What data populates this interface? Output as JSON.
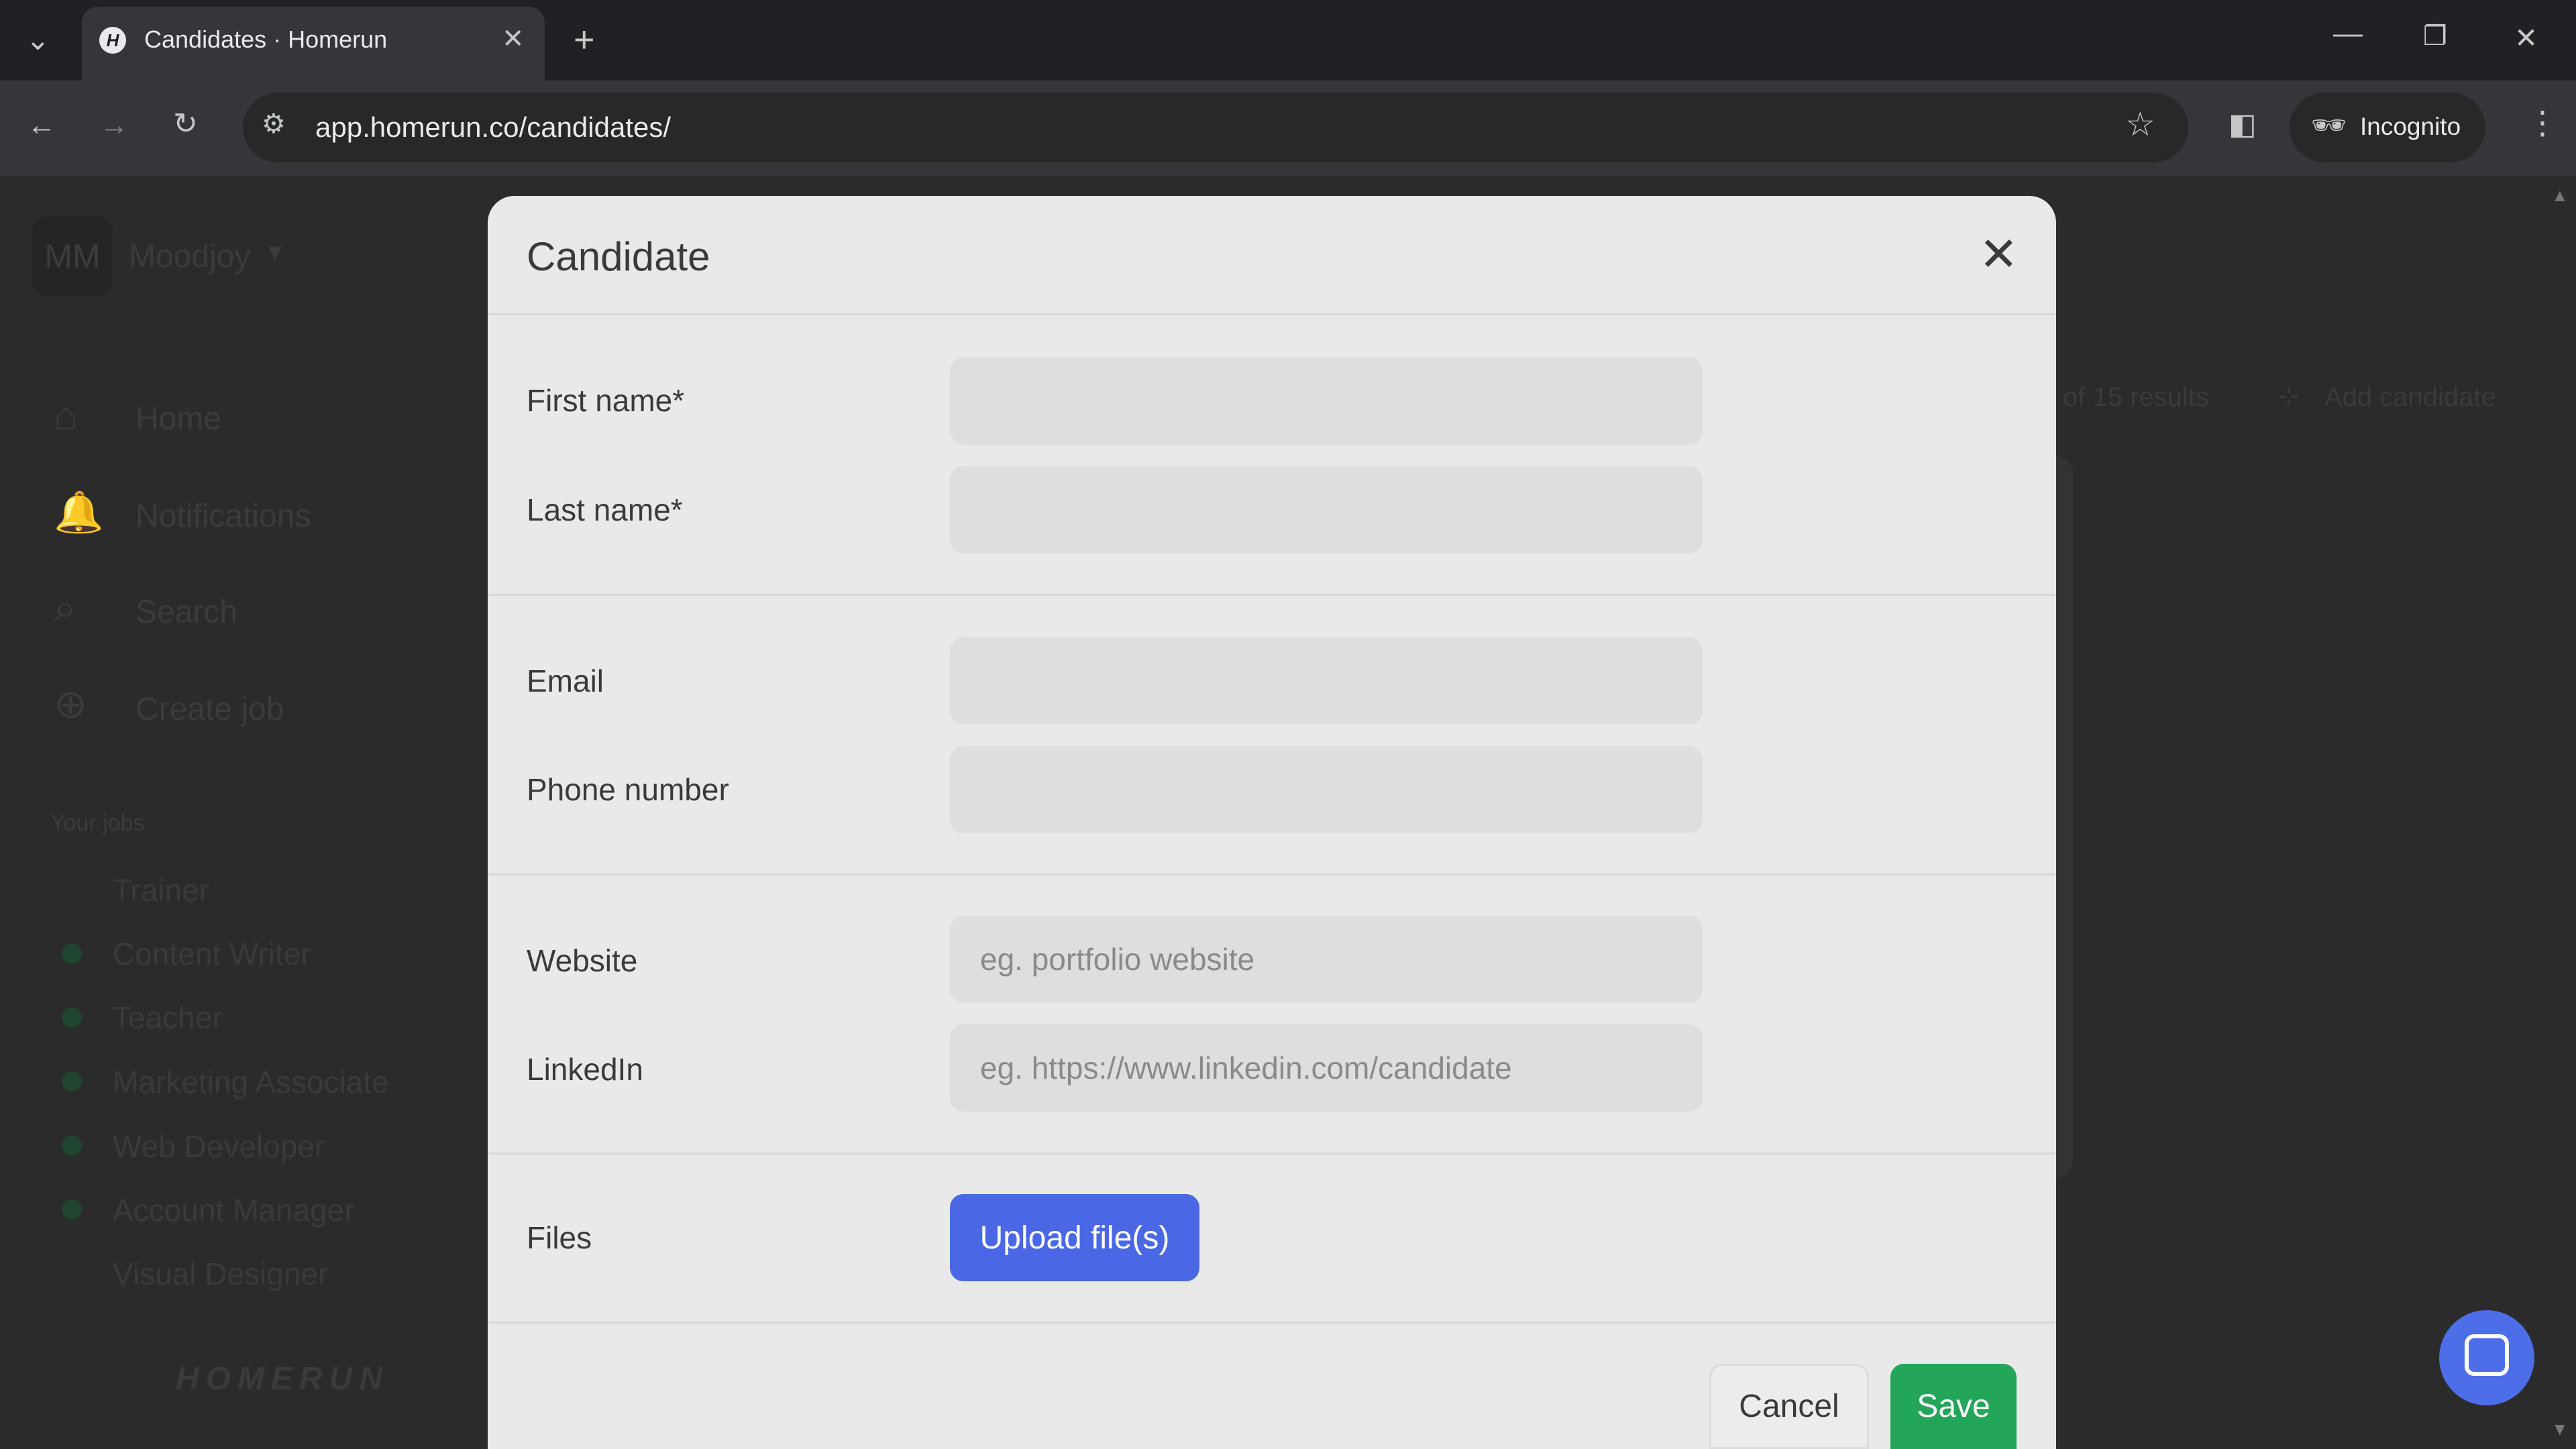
{
  "browser": {
    "tab_title": "Candidates · Homerun",
    "url": "app.homerun.co/candidates/",
    "incognito_label": "Incognito"
  },
  "background": {
    "workspace_initials": "MM",
    "workspace_name": "Moodjoy",
    "nav": [
      "Home",
      "Notifications",
      "Search",
      "Create job"
    ],
    "your_jobs_label": "Your jobs",
    "jobs": [
      "Trainer",
      "Content Writer",
      "Teacher",
      "Marketing Associate",
      "Web Developer",
      "Account Manager",
      "Visual Designer"
    ],
    "logo": "HOMERUN",
    "results_text": "of 15 results",
    "add_candidate": "Add candidate"
  },
  "modal": {
    "title": "Candidate",
    "fields": {
      "first_name": {
        "label": "First name*",
        "value": "",
        "placeholder": ""
      },
      "last_name": {
        "label": "Last name*",
        "value": "",
        "placeholder": ""
      },
      "email": {
        "label": "Email",
        "value": "",
        "placeholder": ""
      },
      "phone": {
        "label": "Phone number",
        "value": "",
        "placeholder": ""
      },
      "website": {
        "label": "Website",
        "value": "",
        "placeholder": "eg. portfolio website"
      },
      "linkedin": {
        "label": "LinkedIn",
        "value": "",
        "placeholder": "eg. https://www.linkedin.com/candidate"
      }
    },
    "files_label": "Files",
    "upload_label": "Upload file(s)",
    "cancel_label": "Cancel",
    "save_label": "Save"
  },
  "colors": {
    "primary_button": "#4a68e6",
    "save_button": "#24a65a",
    "modal_bg": "#e9e9e9"
  }
}
